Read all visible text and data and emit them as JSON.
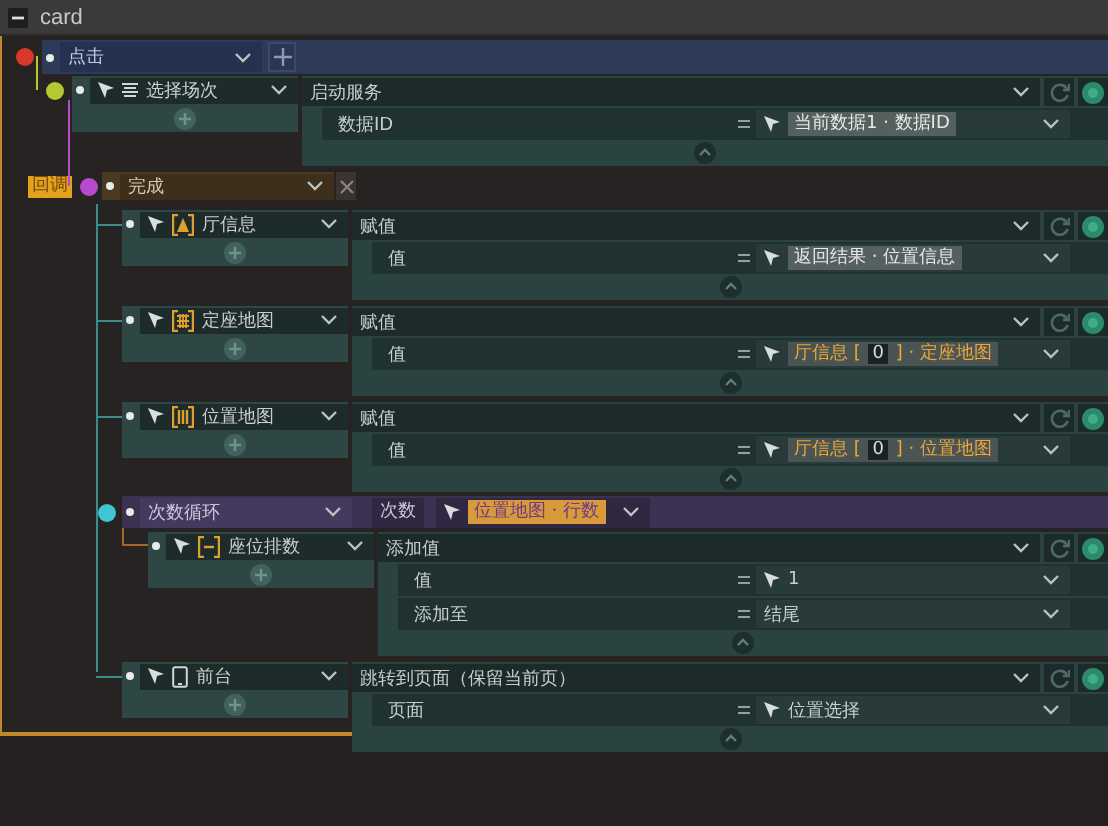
{
  "window": {
    "title": "card"
  },
  "event": {
    "trigger": "点击"
  },
  "steps": [
    {
      "kind": "action",
      "name": "选择场次",
      "action": "启动服务",
      "params": [
        {
          "label": "数据ID",
          "value": {
            "kind": "result",
            "pointer": true,
            "parts": [
              {
                "text": "当前数据1 · 数据ID"
              }
            ]
          }
        }
      ],
      "callback": {
        "label": "回调",
        "event": "完成",
        "steps": [
          {
            "kind": "action",
            "name": "厅信息",
            "action": "赋值",
            "params": [
              {
                "label": "值",
                "value": {
                  "kind": "result",
                  "pointer": true,
                  "parts": [
                    {
                      "text": "返回结果 · 位置信息"
                    }
                  ]
                }
              }
            ]
          },
          {
            "kind": "action",
            "name": "定座地图",
            "action": "赋值",
            "params": [
              {
                "label": "值",
                "value": {
                  "kind": "variable",
                  "pointer": true,
                  "parts": [
                    {
                      "text": "厅信息 ["
                    },
                    {
                      "text": "0",
                      "index": true
                    },
                    {
                      "text": "] · 定座地图"
                    }
                  ]
                }
              }
            ]
          },
          {
            "kind": "action",
            "name": "位置地图",
            "action": "赋值",
            "params": [
              {
                "label": "值",
                "value": {
                  "kind": "variable",
                  "pointer": true,
                  "parts": [
                    {
                      "text": "厅信息 ["
                    },
                    {
                      "text": "0",
                      "index": true
                    },
                    {
                      "text": "] · 位置地图"
                    }
                  ]
                }
              }
            ]
          },
          {
            "kind": "loop",
            "name": "次数循环",
            "count_label": "次数",
            "count": {
              "kind": "variable",
              "pointer": true,
              "parts": [
                {
                  "text": "位置地图 · 行数"
                }
              ]
            },
            "steps": [
              {
                "kind": "action",
                "name": "座位排数",
                "action": "添加值",
                "params": [
                  {
                    "label": "值",
                    "value": {
                      "kind": "literal",
                      "pointer": true,
                      "parts": [
                        {
                          "text": "1"
                        }
                      ]
                    }
                  },
                  {
                    "label": "添加至",
                    "value": {
                      "kind": "literal",
                      "pointer": false,
                      "parts": [
                        {
                          "text": "结尾"
                        }
                      ]
                    }
                  }
                ]
              }
            ]
          },
          {
            "kind": "action",
            "name": "前台",
            "action": "跳转到页面（保留当前页）",
            "params": [
              {
                "label": "页面",
                "value": {
                  "kind": "literal",
                  "pointer": true,
                  "parts": [
                    {
                      "text": "位置选择"
                    }
                  ]
                }
              }
            ]
          }
        ]
      }
    }
  ]
}
